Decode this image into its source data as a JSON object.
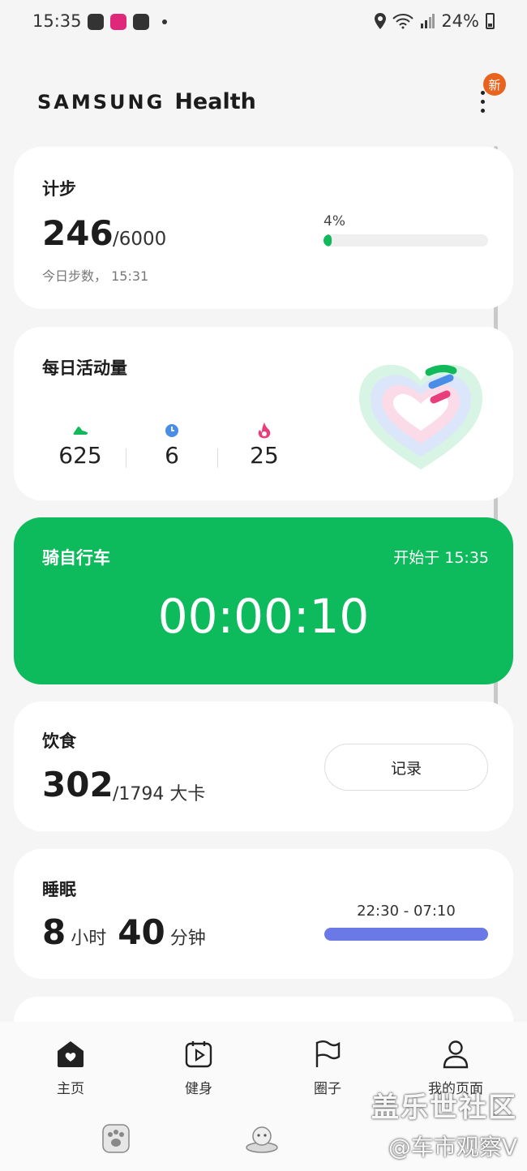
{
  "status_bar": {
    "time": "15:35",
    "battery": "24%"
  },
  "header": {
    "brand_samsung": "SAMSUNG",
    "brand_health": "Health",
    "new_badge": "新"
  },
  "steps": {
    "title": "计步",
    "count": "246",
    "goal": "/6000",
    "subtitle": "今日步数， 15:31",
    "percent_label": "4%",
    "progress": 0.04,
    "color": "#10b95a"
  },
  "activity": {
    "title": "每日活动量",
    "stats": [
      {
        "icon": "shoe-icon",
        "value": "625",
        "color": "#10b95a"
      },
      {
        "icon": "clock-icon",
        "value": "6",
        "color": "#4a8de6"
      },
      {
        "icon": "flame-icon",
        "value": "25",
        "color": "#e83e7a"
      }
    ]
  },
  "bike": {
    "title": "骑自行车",
    "started": "开始于 15:35",
    "timer": "00:00:10",
    "color": "#0dbb5c"
  },
  "food": {
    "title": "饮食",
    "value": "302",
    "goal": "/1794 大卡",
    "record_button": "记录"
  },
  "sleep": {
    "title": "睡眠",
    "hours": "8",
    "hours_unit": "小时",
    "minutes": "40",
    "minutes_unit": "分钟",
    "range": "22:30 - 07:10",
    "color": "#6b79e6"
  },
  "nav": {
    "items": [
      {
        "label": "主页",
        "icon": "home-heart-icon"
      },
      {
        "label": "健身",
        "icon": "fitness-play-icon"
      },
      {
        "label": "圈子",
        "icon": "flag-icon"
      },
      {
        "label": "我的页面",
        "icon": "person-icon"
      }
    ]
  },
  "watermark": {
    "line1": "盖乐世社区",
    "line2": "@车市观察V"
  }
}
